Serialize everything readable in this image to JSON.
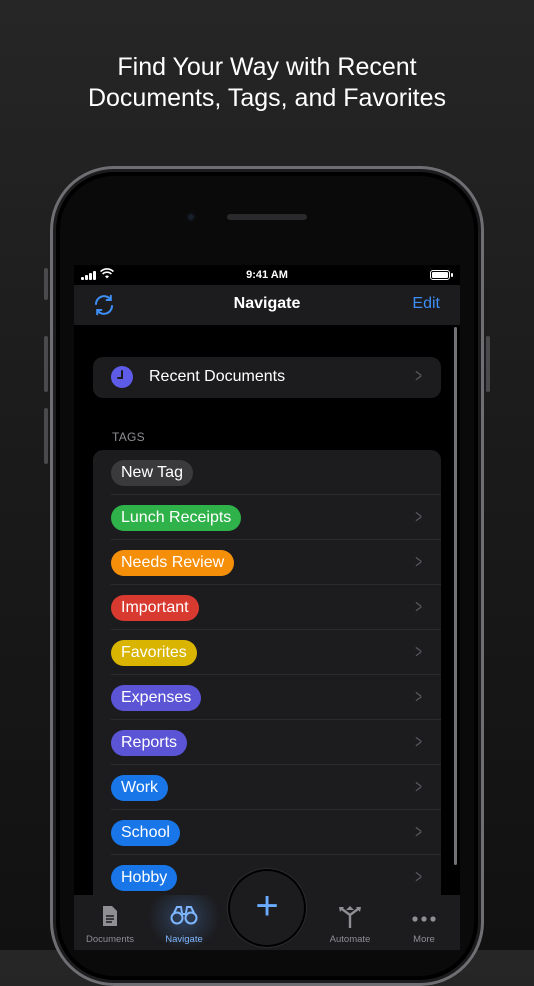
{
  "headline": {
    "line1": "Find Your Way with Recent",
    "line2": "Documents, Tags, and Favorites"
  },
  "status_bar": {
    "time": "9:41 AM"
  },
  "nav": {
    "title": "Navigate",
    "edit_label": "Edit"
  },
  "recent": {
    "label": "Recent Documents"
  },
  "tags_section": {
    "header": "TAGS",
    "items": [
      {
        "label": "New Tag",
        "color": "#3a3a3c"
      },
      {
        "label": "Lunch Receipts",
        "color": "#30b24b"
      },
      {
        "label": "Needs Review",
        "color": "#f58f0a"
      },
      {
        "label": "Important",
        "color": "#d83a30"
      },
      {
        "label": "Favorites",
        "color": "#d9b400"
      },
      {
        "label": "Expenses",
        "color": "#5b55d6"
      },
      {
        "label": "Reports",
        "color": "#5b55d6"
      },
      {
        "label": "Work",
        "color": "#1976e8"
      },
      {
        "label": "School",
        "color": "#1976e8"
      },
      {
        "label": "Hobby",
        "color": "#1976e8"
      }
    ]
  },
  "tabbar": {
    "documents": "Documents",
    "navigate": "Navigate",
    "automate": "Automate",
    "more": "More"
  },
  "icons": {
    "sync": "sync-icon",
    "clock": "clock-icon",
    "chevron": "chevron-right-icon",
    "plus": "plus-icon"
  },
  "colors": {
    "accent": "#3d8ef7",
    "active_tab": "#7eb6ff"
  }
}
